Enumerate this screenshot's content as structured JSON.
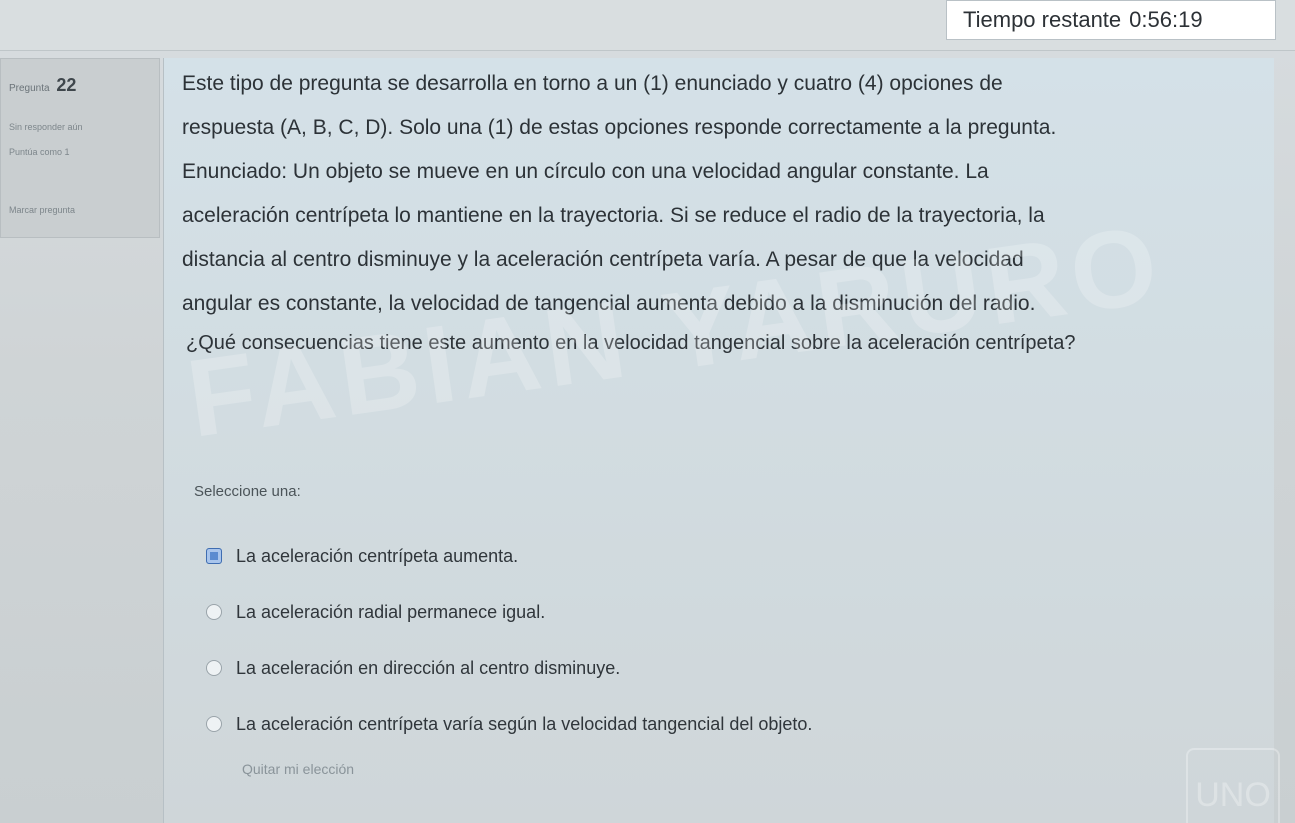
{
  "timer": {
    "label": "Tiempo restante",
    "value": "0:56:19"
  },
  "question_info": {
    "number": "22",
    "number_prefix": "Pregunta",
    "status": "Sin responder aún",
    "points": "Puntúa como 1",
    "flag_label": "Marcar pregunta"
  },
  "question": {
    "intro_line1": "Este tipo de pregunta se desarrolla en torno a un (1) enunciado y cuatro (4) opciones de",
    "intro_line2": "respuesta (A, B, C, D). Solo una (1) de estas opciones responde correctamente a la pregunta.",
    "stem_line1": "Enunciado: Un objeto se mueve en un círculo con una velocidad angular constante. La",
    "stem_line2": "aceleración centrípeta lo mantiene en la trayectoria. Si se reduce el radio de la trayectoria, la",
    "stem_line3": "distancia al centro disminuye y la aceleración centrípeta varía. A pesar de que la velocidad",
    "stem_line4": "angular es constante, la velocidad de tangencial aumenta debido a la disminución del radio.",
    "prompt": "¿Qué consecuencias tiene este aumento en la velocidad tangencial sobre la aceleración centrípeta?"
  },
  "select_label": "Seleccione una:",
  "options": [
    {
      "text": "La aceleración centrípeta aumenta.",
      "selected": true
    },
    {
      "text": "La aceleración radial permanece igual.",
      "selected": false
    },
    {
      "text": "La aceleración en dirección al centro disminuye.",
      "selected": false
    },
    {
      "text": "La aceleración centrípeta varía según la velocidad tangencial del objeto.",
      "selected": false
    }
  ],
  "clear_choice": "Quitar mi elección",
  "watermark": "FABIAN YARURO",
  "logo_text": "UNO"
}
